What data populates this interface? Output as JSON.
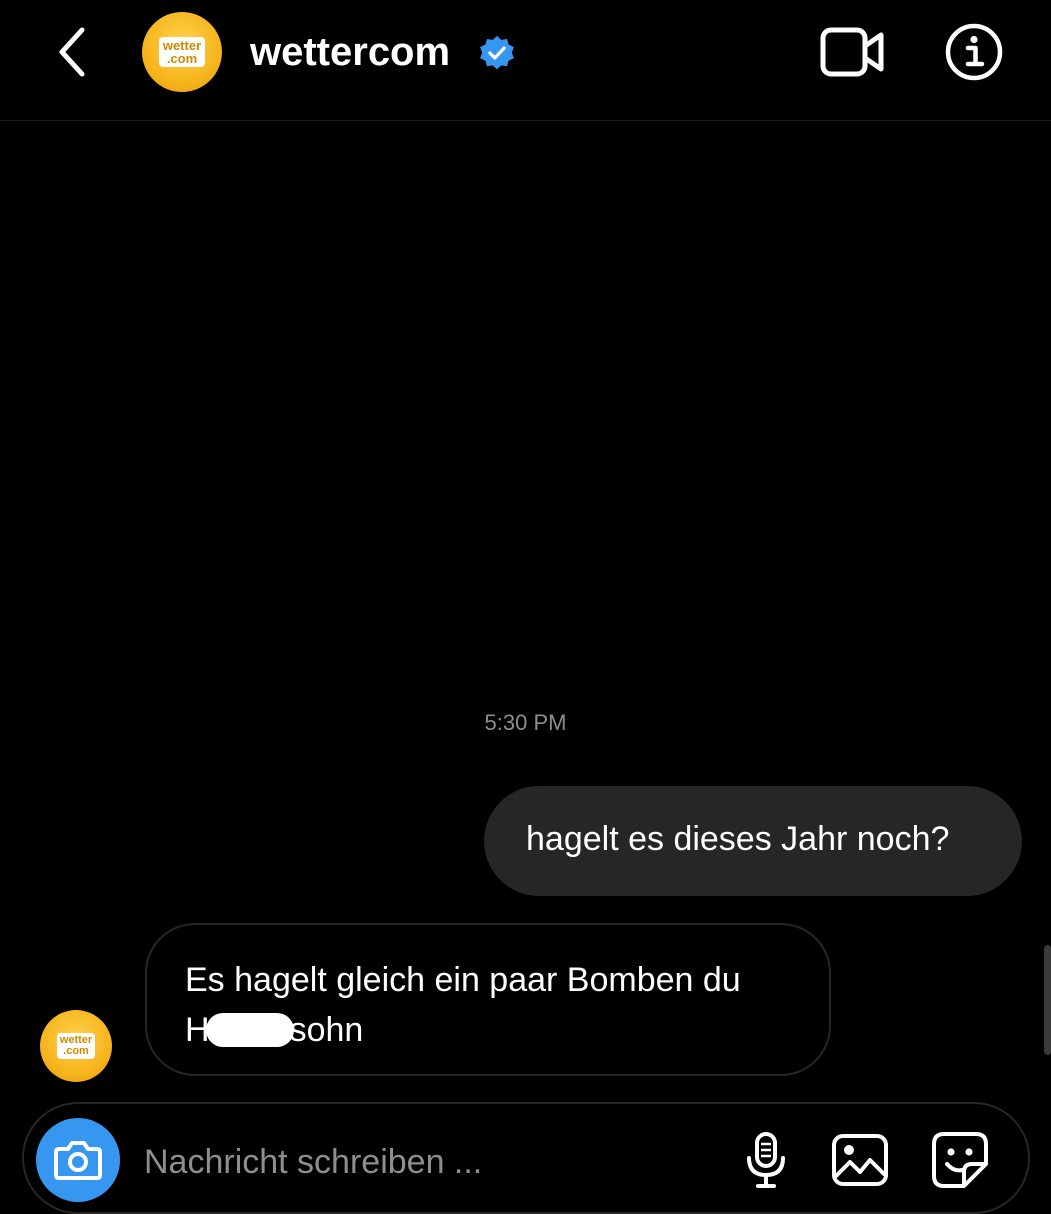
{
  "header": {
    "username": "wettercom",
    "avatar_logo": "wetter.com",
    "back_icon": "chevron-left-icon",
    "verified_icon": "verified-badge-icon",
    "video_icon": "video-camera-icon",
    "info_icon": "info-icon",
    "verified_color": "#3797f0"
  },
  "conversation": {
    "timestamp": "5:30 PM",
    "outgoing": {
      "text": "hagelt es dieses Jahr noch?"
    },
    "incoming": {
      "line1": "Es hagelt gleich ein paar Bomben du",
      "line2_prefix": "H",
      "line2_suffix": "sohn",
      "avatar_logo": "wetter.com"
    }
  },
  "composer": {
    "placeholder": "Nachricht schreiben ...",
    "camera_icon": "camera-icon",
    "mic_icon": "microphone-icon",
    "gallery_icon": "image-gallery-icon",
    "sticker_icon": "sticker-icon",
    "accent": "#3797f0"
  },
  "colors": {
    "background": "#000000",
    "bubble": "#262626",
    "secondary_text": "#8e8e8e"
  }
}
